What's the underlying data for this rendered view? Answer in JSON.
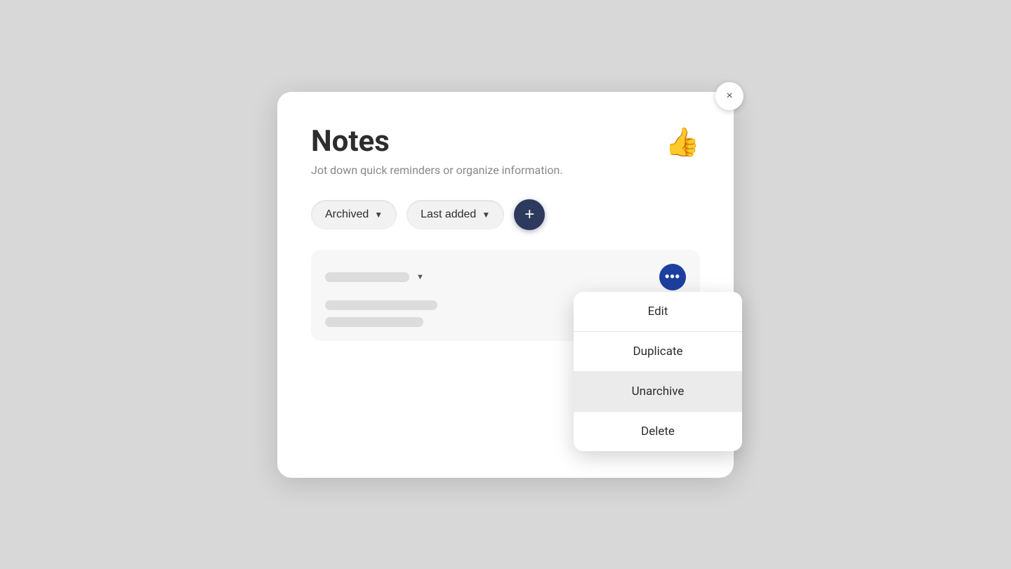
{
  "modal": {
    "title": "Notes",
    "subtitle": "Jot down quick reminders or organize information.",
    "close_label": "×",
    "emoji_icon": "👍"
  },
  "filters": {
    "status_label": "Archived",
    "sort_label": "Last added"
  },
  "add_button_label": "+",
  "context_menu": {
    "items": [
      {
        "label": "Edit",
        "highlighted": false
      },
      {
        "label": "Duplicate",
        "highlighted": false
      },
      {
        "label": "Unarchive",
        "highlighted": true
      },
      {
        "label": "Delete",
        "highlighted": false
      }
    ]
  },
  "note_card": {
    "three_dots_label": "⋯"
  }
}
